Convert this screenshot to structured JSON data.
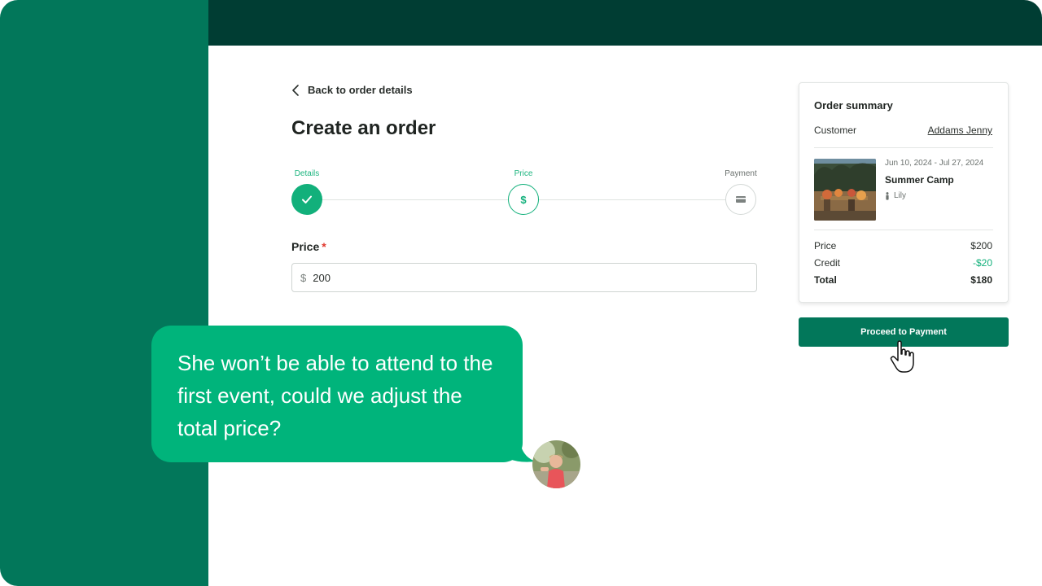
{
  "nav": {
    "back_label": "Back to order details"
  },
  "page": {
    "title": "Create an order"
  },
  "stepper": {
    "steps": [
      {
        "label": "Details",
        "state": "complete"
      },
      {
        "label": "Price",
        "state": "current",
        "icon": "$"
      },
      {
        "label": "Payment",
        "state": "upcoming"
      }
    ]
  },
  "price_field": {
    "label": "Price",
    "required_mark": "*",
    "currency": "$",
    "value": "200"
  },
  "summary": {
    "title": "Order summary",
    "customer_label": "Customer",
    "customer_name": "Addams Jenny",
    "event": {
      "dates": "Jun 10, 2024 - Jul 27, 2024",
      "name": "Summer Camp",
      "attendee": "Lily"
    },
    "price_label": "Price",
    "price_value": "$200",
    "credit_label": "Credit",
    "credit_value": "-$20",
    "total_label": "Total",
    "total_value": "$180"
  },
  "actions": {
    "proceed_label": "Proceed to Payment"
  },
  "chat": {
    "message": "She won’t be able to attend to the first event, could we adjust the total price?"
  },
  "colors": {
    "brand_green": "#02775a",
    "dark_green": "#003d33",
    "accent_green": "#00b47b",
    "required_red": "#e0382e"
  }
}
